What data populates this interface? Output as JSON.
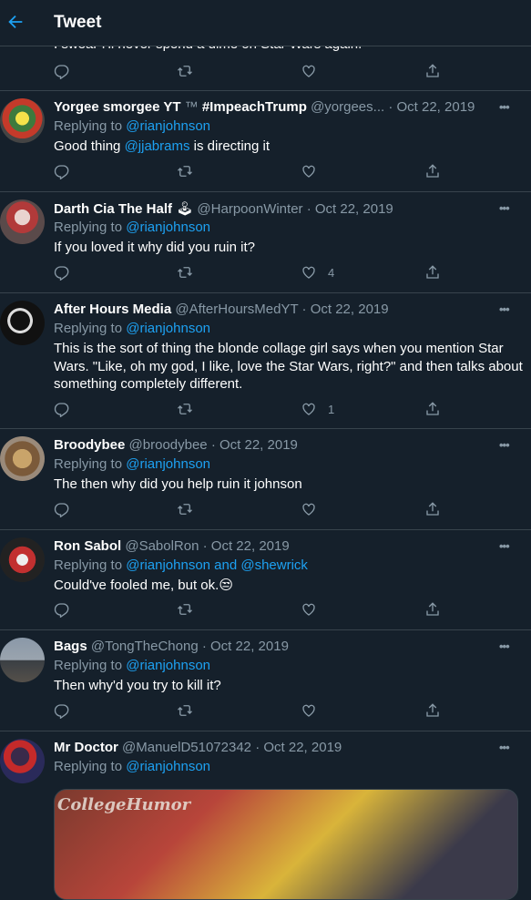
{
  "header": {
    "title": "Tweet"
  },
  "partial_tweet": {
    "text": "I swear I'll never spend a dime on Star Wars again."
  },
  "tweets": [
    {
      "name": "Yorgee smorgee YT",
      "name_extra": "™",
      "name_tag": "#ImpeachTrump",
      "handle": "@yorgees...",
      "date": "Oct 22, 2019",
      "replying_label": "Replying to",
      "replying_to": "@rianjohnson",
      "text_before": "Good thing ",
      "text_link": "@jjabrams",
      "text_after": " is directing it",
      "likes": ""
    },
    {
      "name": "Darth Cia The Half",
      "name_emoji": "🕹",
      "handle": "@HarpoonWinter",
      "date": "Oct 22, 2019",
      "replying_label": "Replying to",
      "replying_to": "@rianjohnson",
      "text": "If you loved it why did you ruin it?",
      "likes": "4"
    },
    {
      "name": "After Hours Media",
      "handle": "@AfterHoursMedYT",
      "date": "Oct 22, 2019",
      "replying_label": "Replying to",
      "replying_to": "@rianjohnson",
      "text": "This is the sort of thing the blonde collage girl says when you mention Star Wars. \"Like, oh my god, I like, love the Star Wars, right?\" and then talks about something completely different.",
      "likes": "1"
    },
    {
      "name": "Broodybee",
      "handle": "@broodybee",
      "date": "Oct 22, 2019",
      "replying_label": "Replying to",
      "replying_to": "@rianjohnson",
      "text": "The then why did you help ruin it johnson",
      "likes": ""
    },
    {
      "name": "Ron Sabol",
      "handle": "@SabolRon",
      "date": "Oct 22, 2019",
      "replying_label": "Replying to",
      "replying_to": "@rianjohnson and @shewrick",
      "text": "Could've fooled me, but ok.",
      "text_emoji": "😒",
      "likes": ""
    },
    {
      "name": "Bags",
      "handle": "@TongTheChong",
      "date": "Oct 22, 2019",
      "replying_label": "Replying to",
      "replying_to": "@rianjohnson",
      "text": "Then why'd you try to kill it?",
      "likes": ""
    },
    {
      "name": "Mr Doctor",
      "handle": "@ManuelD51072342",
      "date": "Oct 22, 2019",
      "replying_label": "Replying to",
      "replying_to": "@rianjohnson",
      "media_logo": "CollegeHumor"
    }
  ],
  "colors": {
    "background": "#15202b",
    "border": "#38444d",
    "secondary_text": "#8899a6",
    "accent": "#1da1f2"
  },
  "icons": [
    "back-arrow-icon",
    "reply-icon",
    "retweet-icon",
    "like-icon",
    "share-icon",
    "more-icon"
  ]
}
